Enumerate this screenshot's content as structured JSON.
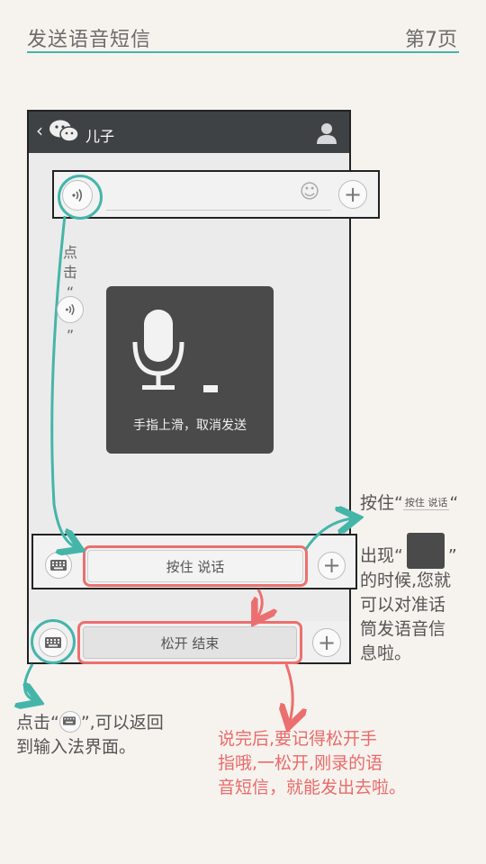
{
  "header": {
    "title": "发送语音短信",
    "page_label": "第7页"
  },
  "chat": {
    "back_glyph": "‹",
    "contact_name": "儿子"
  },
  "input_row": {
    "smiley_glyph": "☺",
    "plus_glyph": "+"
  },
  "recording_overlay": {
    "hint": "手指上滑，取消发送"
  },
  "hold_row": {
    "button_label": "按住 说话",
    "plus_glyph": "+"
  },
  "release_row": {
    "button_label": "松开 结束",
    "plus_glyph": "+"
  },
  "annotations": {
    "click_char1": "点",
    "click_char2": "击",
    "open_quote": "“",
    "close_quote": "”",
    "press_prefix": "按住“",
    "press_chip": "按住 说话",
    "press_suffix": "“",
    "appear_prefix": "出现“",
    "appear_suffix": "”",
    "appear_rest": [
      "的时候,您就",
      "可以对准话",
      "筒发语音信",
      "息啦。"
    ],
    "kbd_prefix": "点击“",
    "kbd_suffix": "”,可以返回",
    "kbd_line2": "到输入法界面。",
    "done_lines": [
      "说完后,要记得松开手",
      "指哦,一松开,刚录的语",
      "音短信，就能发出去啦。"
    ]
  },
  "colors": {
    "accent_teal": "#45b5aa",
    "accent_red": "#ec6f6f",
    "rule": "#45b5aa"
  }
}
